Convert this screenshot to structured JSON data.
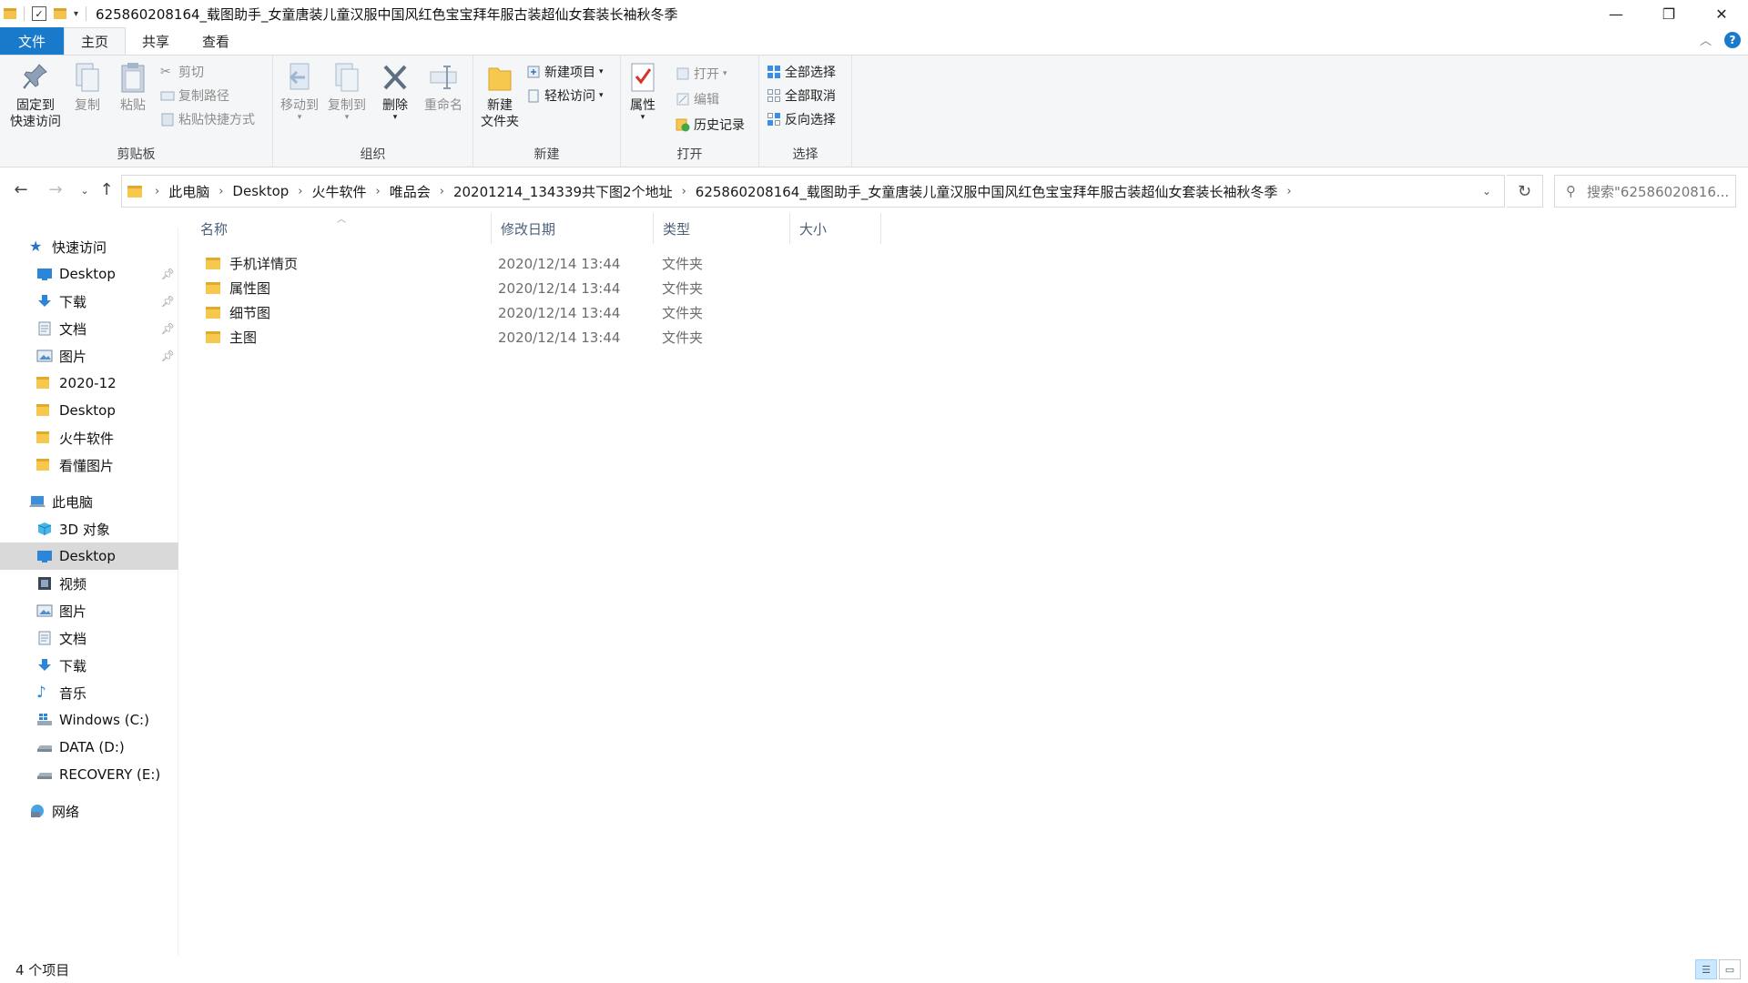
{
  "window": {
    "title": "625860208164_载图助手_女童唐装儿童汉服中国风红色宝宝拜年服古装超仙女套装长袖秋冬季",
    "minimize": "—",
    "restore": "❐",
    "close": "✕"
  },
  "tabs": {
    "file": "文件",
    "home": "主页",
    "share": "共享",
    "view": "查看"
  },
  "ribbon": {
    "clipboard": {
      "label": "剪贴板",
      "pin_l1": "固定到",
      "pin_l2": "快速访问",
      "copy": "复制",
      "paste": "粘贴",
      "cut": "剪切",
      "copy_path": "复制路径",
      "paste_shortcut": "粘贴快捷方式"
    },
    "organize": {
      "label": "组织",
      "move_to": "移动到",
      "copy_to": "复制到",
      "delete": "删除",
      "rename": "重命名"
    },
    "new": {
      "label": "新建",
      "new_folder_l1": "新建",
      "new_folder_l2": "文件夹",
      "new_item": "新建项目",
      "easy_access": "轻松访问"
    },
    "open": {
      "label": "打开",
      "properties": "属性",
      "open": "打开",
      "edit": "编辑",
      "history": "历史记录"
    },
    "select": {
      "label": "选择",
      "select_all": "全部选择",
      "select_none": "全部取消",
      "invert": "反向选择"
    }
  },
  "address": {
    "crumbs": [
      "此电脑",
      "Desktop",
      "火牛软件",
      "唯品会",
      "20201214_134339共下图2个地址",
      "625860208164_载图助手_女童唐装儿童汉服中国风红色宝宝拜年服古装超仙女套装长袖秋冬季"
    ],
    "search_placeholder": "搜索\"62586020816..."
  },
  "nav": {
    "quick_access": "快速访问",
    "quick_items": [
      {
        "label": "Desktop",
        "icon": "desktop-icon",
        "pinned": true
      },
      {
        "label": "下载",
        "icon": "download-icon",
        "pinned": true
      },
      {
        "label": "文档",
        "icon": "document-icon",
        "pinned": true
      },
      {
        "label": "图片",
        "icon": "picture-icon",
        "pinned": true
      },
      {
        "label": "2020-12",
        "icon": "folder-icon",
        "pinned": false
      },
      {
        "label": "Desktop",
        "icon": "folder-icon",
        "pinned": false
      },
      {
        "label": "火牛软件",
        "icon": "folder-icon",
        "pinned": false
      },
      {
        "label": "看懂图片",
        "icon": "folder-icon",
        "pinned": false
      }
    ],
    "this_pc": "此电脑",
    "pc_items": [
      {
        "label": "3D 对象",
        "icon": "3d-objects-icon"
      },
      {
        "label": "Desktop",
        "icon": "desktop-icon"
      },
      {
        "label": "视频",
        "icon": "video-icon"
      },
      {
        "label": "图片",
        "icon": "picture-icon"
      },
      {
        "label": "文档",
        "icon": "document-icon"
      },
      {
        "label": "下载",
        "icon": "download-icon"
      },
      {
        "label": "音乐",
        "icon": "music-icon"
      },
      {
        "label": "Windows (C:)",
        "icon": "windows-drive-icon"
      },
      {
        "label": "DATA (D:)",
        "icon": "drive-icon"
      },
      {
        "label": "RECOVERY (E:)",
        "icon": "drive-icon"
      }
    ],
    "network": "网络"
  },
  "columns": {
    "name": "名称",
    "date": "修改日期",
    "type": "类型",
    "size": "大小"
  },
  "files": [
    {
      "name": "手机详情页",
      "date": "2020/12/14 13:44",
      "type": "文件夹",
      "size": ""
    },
    {
      "name": "属性图",
      "date": "2020/12/14 13:44",
      "type": "文件夹",
      "size": ""
    },
    {
      "name": "细节图",
      "date": "2020/12/14 13:44",
      "type": "文件夹",
      "size": ""
    },
    {
      "name": "主图",
      "date": "2020/12/14 13:44",
      "type": "文件夹",
      "size": ""
    }
  ],
  "status": {
    "item_count": "4 个项目"
  }
}
